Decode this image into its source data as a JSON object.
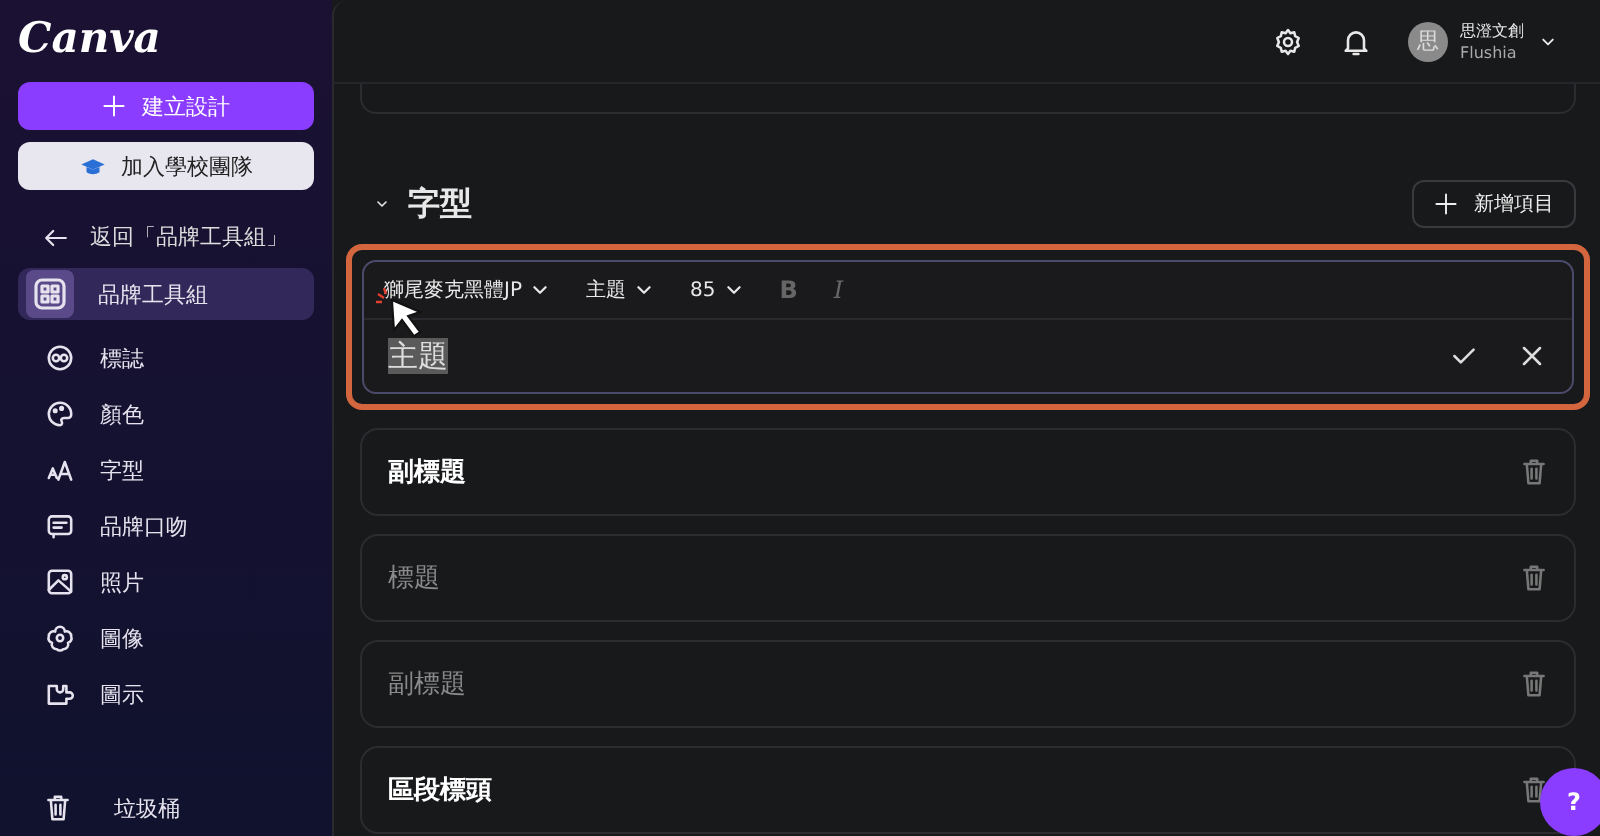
{
  "sidebar": {
    "logo": "Canva",
    "create_button": "建立設計",
    "join_button": "加入學校團隊",
    "back_link": "返回「品牌工具組」",
    "items": [
      {
        "label": "品牌工具組",
        "selected": true
      },
      {
        "label": "標誌",
        "selected": false
      },
      {
        "label": "顏色",
        "selected": false
      },
      {
        "label": "字型",
        "selected": false
      },
      {
        "label": "品牌口吻",
        "selected": false
      },
      {
        "label": "照片",
        "selected": false
      },
      {
        "label": "圖像",
        "selected": false
      },
      {
        "label": "圖示",
        "selected": false
      }
    ],
    "trash": "垃圾桶"
  },
  "header": {
    "avatar_initial": "思",
    "user_name": "思澄文創",
    "team": "Flushia"
  },
  "section": {
    "title": "字型",
    "expanded": true,
    "add_button": "新增項目",
    "editor": {
      "font": "獅尾麥克黑體JP",
      "style": "主題",
      "size": "85",
      "bold": {
        "label": "B",
        "on": false
      },
      "italic": {
        "label": "I",
        "on": false
      },
      "value": "主題",
      "highlighted": true
    },
    "rows": [
      {
        "label": "副標題",
        "dimmed": false
      },
      {
        "label": "標題",
        "dimmed": true
      },
      {
        "label": "副標題",
        "dimmed": true
      },
      {
        "label": "區段標頭",
        "dimmed": false
      }
    ]
  },
  "help_button": "?"
}
